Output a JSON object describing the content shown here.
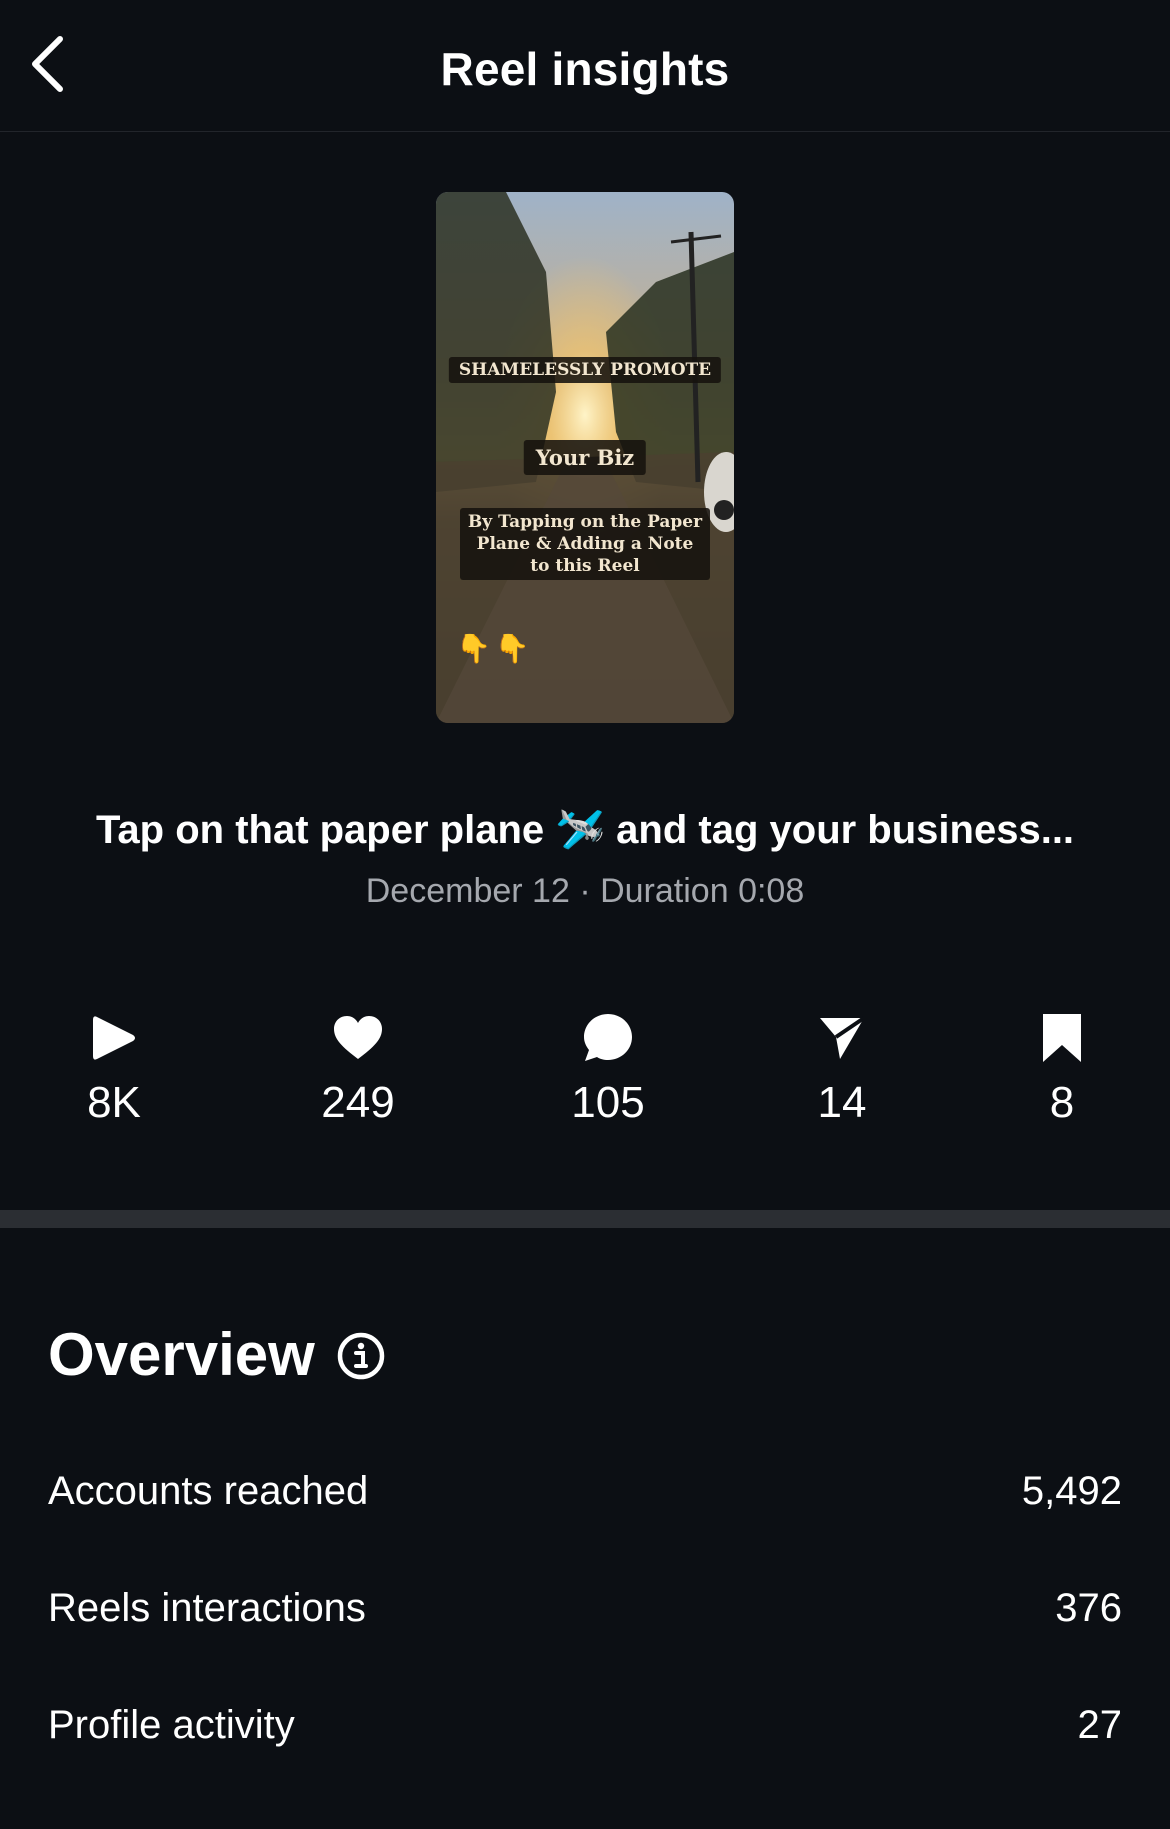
{
  "header": {
    "title": "Reel insights",
    "back_icon": "chevron-left-icon"
  },
  "reel": {
    "thumbnail_overlay": {
      "line1": "SHAMELESSLY PROMOTE",
      "line2": "Your Biz",
      "line3": "By Tapping on the Paper Plane & Adding a Note to this Reel",
      "emoji": "👇👇"
    },
    "caption": "Tap on that paper plane 🛩️ and tag your business...",
    "date": "December 12",
    "separator": "·",
    "duration_label": "Duration",
    "duration": "0:08"
  },
  "stats": [
    {
      "icon": "play-icon",
      "value": "8K"
    },
    {
      "icon": "heart-icon",
      "value": "249"
    },
    {
      "icon": "comment-icon",
      "value": "105"
    },
    {
      "icon": "paper-plane-icon",
      "value": "14"
    },
    {
      "icon": "bookmark-icon",
      "value": "8"
    }
  ],
  "overview": {
    "title": "Overview",
    "info_icon": "info-icon",
    "rows": [
      {
        "label": "Accounts reached",
        "value": "5,492"
      },
      {
        "label": "Reels interactions",
        "value": "376"
      },
      {
        "label": "Profile activity",
        "value": "27"
      }
    ]
  },
  "colors": {
    "background": "#0c0f14",
    "text": "#ffffff",
    "muted": "#a5a8ae",
    "divider": "#2b2e33"
  }
}
